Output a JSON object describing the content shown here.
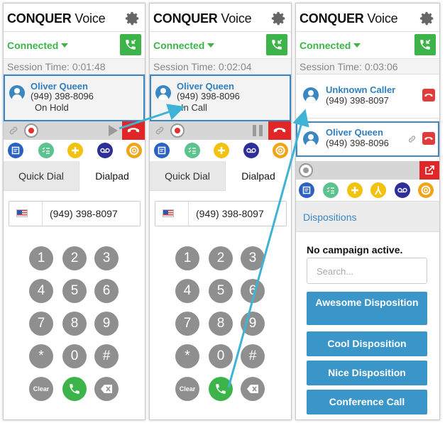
{
  "brand": {
    "bold": "CONQUER",
    "light": "Voice"
  },
  "status": "Connected",
  "panels": [
    {
      "session_time": "Session Time: 0:01:48",
      "call": {
        "name": "Oliver Queen",
        "number": "(949) 398-8096",
        "state": "On Hold"
      },
      "tabs": [
        "Quick Dial",
        "Dialpad"
      ],
      "dial_value": "(949) 398-8097"
    },
    {
      "session_time": "Session Time: 0:02:04",
      "call": {
        "name": "Oliver Queen",
        "number": "(949) 398-8096",
        "state": "In Call"
      },
      "tabs": [
        "Quick Dial",
        "Dialpad"
      ],
      "dial_value": "(949) 398-8097"
    },
    {
      "session_time": "Session Time: 0:03:06",
      "calls": [
        {
          "name": "Unknown Caller",
          "number": "(949) 398-8097"
        },
        {
          "name": "Oliver Queen",
          "number": "(949) 398-8096"
        }
      ],
      "dispositions_header": "Dispositions",
      "no_campaign": "No campaign active.",
      "search_placeholder": "Search...",
      "buttons": [
        "Awesome Disposition",
        "Cool Disposition",
        "Nice Disposition",
        "Conference Call"
      ]
    }
  ],
  "keypad": {
    "keys": [
      "1",
      "2",
      "3",
      "4",
      "5",
      "6",
      "7",
      "8",
      "9",
      "*",
      "0",
      "#"
    ],
    "clear": "Clear"
  },
  "icons": {
    "settings": "gear-icon",
    "call_status": "phone-incoming-icon",
    "avatar": "user-avatar-icon",
    "hangup": "phone-hangup-icon",
    "record": "record-icon",
    "link": "link-icon",
    "play": "play-icon",
    "pause": "pause-icon",
    "toolbar": [
      "notes-icon",
      "checklist-icon",
      "add-icon",
      "voicemail-icon",
      "help-lifebuoy-icon"
    ],
    "toolbar_p3": [
      "notes-icon",
      "checklist-icon",
      "add-icon",
      "transfer-icon",
      "voicemail-icon",
      "help-lifebuoy-icon"
    ],
    "popout": "popout-icon",
    "backspace": "backspace-icon",
    "call": "phone-call-icon"
  },
  "colors": {
    "accent_blue": "#3a87c4",
    "green": "#3cb44a",
    "red": "#e02626",
    "button_blue": "#3a96c8",
    "arrow": "#3fb3d6"
  }
}
